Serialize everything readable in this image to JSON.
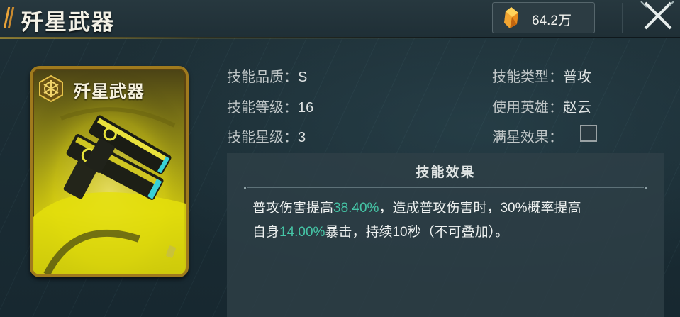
{
  "header": {
    "title": "歼星武器",
    "currency_value": "64.2万"
  },
  "card": {
    "title": "歼星武器"
  },
  "attributes": {
    "quality_label": "技能品质：",
    "quality_value": "S",
    "level_label": "技能等级：",
    "level_value": "16",
    "star_label": "技能星级：",
    "star_value": "3",
    "type_label": "技能类型：",
    "type_value": "普攻",
    "hero_label": "使用英雄：",
    "hero_value": "赵云",
    "fullstar_label": "满星效果："
  },
  "effect": {
    "title": "技能效果",
    "line1_a": "普攻伤害提高",
    "line1_hl": "38.40%",
    "line1_b": "，造成普攻伤害时，30%概率提高",
    "line2_a": "自身",
    "line2_hl": "14.00%",
    "line2_b": "暴击，持续10秒（不可叠加）。"
  },
  "colors": {
    "highlight": "#45c5a6",
    "card_gold": "#d9d10f",
    "accent_orange": "#e8a43a"
  },
  "icons": {
    "currency": "crystal-icon",
    "close": "close-icon",
    "card_badge": "hexagon-badge-icon",
    "fullstar_checkbox": "checkbox-icon"
  }
}
